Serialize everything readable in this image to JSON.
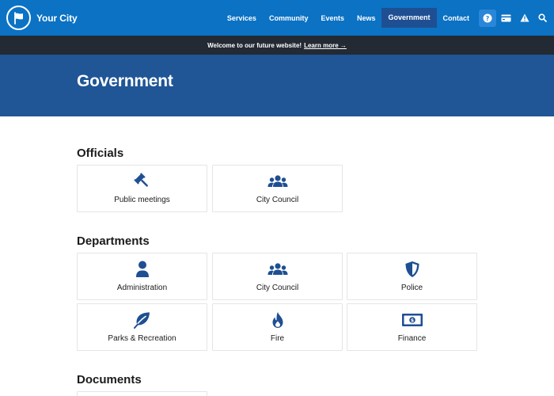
{
  "brand": {
    "name": "Your City",
    "logo_icon": "flag-icon"
  },
  "nav": {
    "links": [
      "Services",
      "Community",
      "Events",
      "News",
      "Government",
      "Contact"
    ],
    "active": "Government",
    "icons": [
      "help-icon",
      "card-icon",
      "alert-icon",
      "search-icon"
    ]
  },
  "banner": {
    "text": "Welcome to our future website!",
    "link": "Learn more →"
  },
  "hero": {
    "title": "Government"
  },
  "officials": {
    "title": "Officials",
    "items": [
      {
        "label": "Public meetings",
        "icon": "gavel-icon"
      },
      {
        "label": "City Council",
        "icon": "people-icon"
      }
    ]
  },
  "departments": {
    "title": "Departments",
    "items": [
      {
        "label": "Administration",
        "icon": "person-icon"
      },
      {
        "label": "City Council",
        "icon": "people-icon"
      },
      {
        "label": "Police",
        "icon": "shield-icon"
      },
      {
        "label": "Parks & Recreation",
        "icon": "leaf-icon"
      },
      {
        "label": "Fire",
        "icon": "flame-icon"
      },
      {
        "label": "Finance",
        "icon": "money-icon"
      }
    ]
  },
  "documents": {
    "title": "Documents"
  },
  "colors": {
    "nav_bg": "#0b72c4",
    "nav_active": "#1f4f93",
    "banner_bg": "#232a33",
    "hero_bg": "#205596",
    "icon_blue": "#1f4f93"
  }
}
